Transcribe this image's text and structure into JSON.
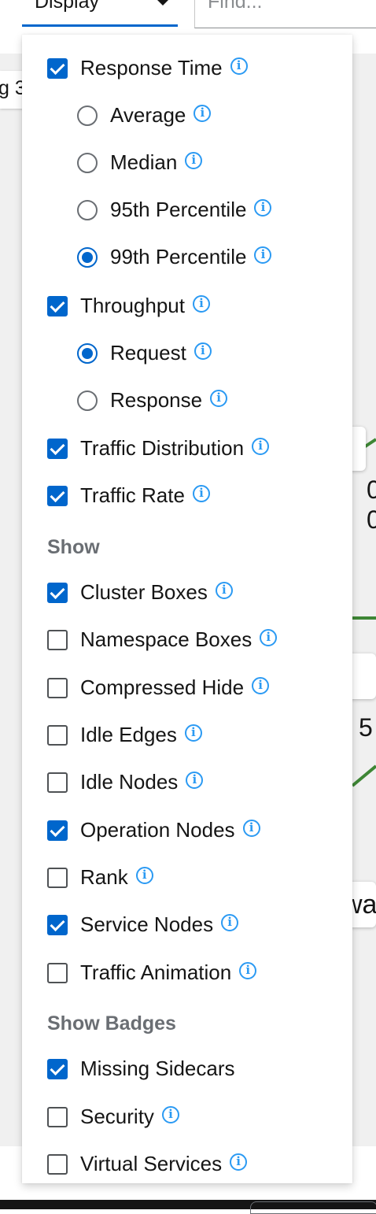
{
  "toolbar": {
    "display_label": "Display",
    "find_placeholder": "Find..."
  },
  "background": {
    "tab_chip_text": "g 3",
    "edge_labels": [
      "0",
      "0",
      ":",
      "5",
      "wa"
    ]
  },
  "menu": {
    "items": [
      {
        "type": "checkbox",
        "label": "Response Time",
        "checked": true
      },
      {
        "type": "radio",
        "label": "Average",
        "checked": false
      },
      {
        "type": "radio",
        "label": "Median",
        "checked": false
      },
      {
        "type": "radio",
        "label": "95th Percentile",
        "checked": false
      },
      {
        "type": "radio",
        "label": "99th Percentile",
        "checked": true
      },
      {
        "type": "checkbox",
        "label": "Throughput",
        "checked": true
      },
      {
        "type": "radio",
        "label": "Request",
        "checked": true
      },
      {
        "type": "radio",
        "label": "Response",
        "checked": false
      },
      {
        "type": "checkbox",
        "label": "Traffic Distribution",
        "checked": true
      },
      {
        "type": "checkbox",
        "label": "Traffic Rate",
        "checked": true
      },
      {
        "type": "checkbox",
        "label": "Cluster Boxes",
        "checked": true
      },
      {
        "type": "checkbox",
        "label": "Namespace Boxes",
        "checked": false
      },
      {
        "type": "checkbox",
        "label": "Compressed Hide",
        "checked": false
      },
      {
        "type": "checkbox",
        "label": "Idle Edges",
        "checked": false
      },
      {
        "type": "checkbox",
        "label": "Idle Nodes",
        "checked": false
      },
      {
        "type": "checkbox",
        "label": "Operation Nodes",
        "checked": true
      },
      {
        "type": "checkbox",
        "label": "Rank",
        "checked": false
      },
      {
        "type": "checkbox",
        "label": "Service Nodes",
        "checked": true
      },
      {
        "type": "checkbox",
        "label": "Traffic Animation",
        "checked": false
      },
      {
        "type": "checkbox",
        "label": "Missing Sidecars",
        "checked": true
      },
      {
        "type": "checkbox",
        "label": "Security",
        "checked": false
      },
      {
        "type": "checkbox",
        "label": "Virtual Services",
        "checked": false
      }
    ],
    "sections": {
      "show": "Show",
      "show_badges": "Show Badges"
    }
  },
  "colors": {
    "accent": "#0066cc",
    "info_icon": "#2b9af3",
    "edge": "#3e8635",
    "section_heading": "#6a6e73"
  },
  "icons": {
    "info": "info-circle-icon",
    "caret": "caret-down-icon"
  }
}
